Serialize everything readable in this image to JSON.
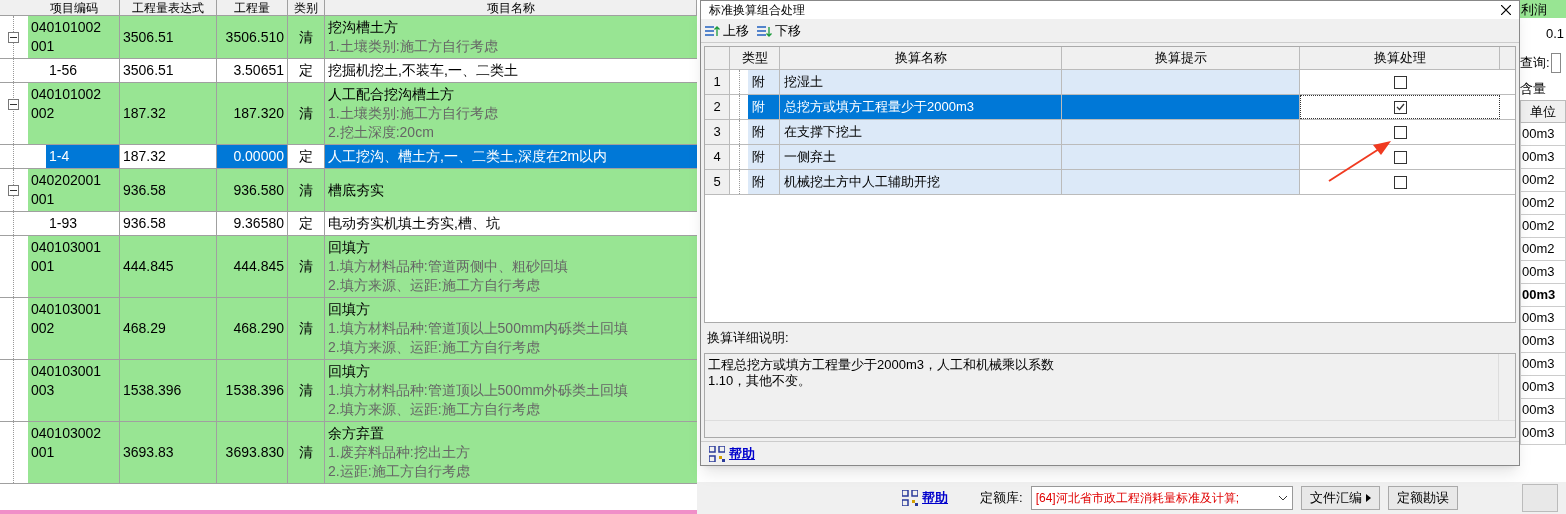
{
  "main_table": {
    "columns": [
      "项目编码",
      "工程量表达式",
      "工程量",
      "类别",
      "项目名称"
    ],
    "rows": [
      {
        "kind": "bill",
        "code": "040101002001",
        "expression": "3506.51",
        "quantity": "3506.510",
        "type": "清",
        "title": "挖沟槽土方",
        "desc": [
          "1.土壤类别:施工方自行考虑"
        ],
        "expanded": true,
        "selected": false,
        "children": [
          {
            "kind": "norm",
            "code": "1-56",
            "expression": "3506.51",
            "quantity": "3.50651",
            "type": "定",
            "title": "挖掘机挖土,不装车,一、二类土",
            "selected": false
          }
        ]
      },
      {
        "kind": "bill",
        "code": "040101002002",
        "expression": "187.32",
        "quantity": "187.320",
        "type": "清",
        "title": "人工配合挖沟槽土方",
        "desc": [
          "1.土壤类别:施工方自行考虑",
          "2.挖土深度:20cm"
        ],
        "expanded": true,
        "selected": false,
        "children": [
          {
            "kind": "norm",
            "code": "1-4",
            "expression": "187.32",
            "quantity": "0.00000",
            "type": "定",
            "title": "人工挖沟、槽土方,一、二类土,深度在2m以内",
            "selected": true
          }
        ]
      },
      {
        "kind": "bill",
        "code": "040202001001",
        "expression": "936.58",
        "quantity": "936.580",
        "type": "清",
        "title": "槽底夯实",
        "desc": [],
        "expanded": true,
        "selected": false,
        "children": [
          {
            "kind": "norm",
            "code": "1-93",
            "expression": "936.58",
            "quantity": "9.36580",
            "type": "定",
            "title": "电动夯实机填土夯实,槽、坑",
            "selected": false
          }
        ]
      },
      {
        "kind": "bill",
        "code": "040103001001",
        "expression": "444.845",
        "quantity": "444.845",
        "type": "清",
        "title": "回填方",
        "desc": [
          "1.填方材料品种:管道两侧中、粗砂回填",
          "2.填方来源、运距:施工方自行考虑"
        ],
        "selected": false
      },
      {
        "kind": "bill",
        "code": "040103001002",
        "expression": "468.29",
        "quantity": "468.290",
        "type": "清",
        "title": "回填方",
        "desc": [
          "1.填方材料品种:管道顶以上500mm内砾类土回填",
          "2.填方来源、运距:施工方自行考虑"
        ],
        "selected": false
      },
      {
        "kind": "bill",
        "code": "040103001003",
        "expression": "1538.396",
        "quantity": "1538.396",
        "type": "清",
        "title": "回填方",
        "desc": [
          "1.填方材料品种:管道顶以上500mm外砾类土回填",
          "2.填方来源、运距:施工方自行考虑"
        ],
        "selected": false
      },
      {
        "kind": "bill",
        "code": "040103002001",
        "expression": "3693.83",
        "quantity": "3693.830",
        "type": "清",
        "title": "余方弃置",
        "desc": [
          "1.废弃料品种:挖出土方",
          "2.运距:施工方自行考虑"
        ],
        "selected": false
      }
    ]
  },
  "side_panel": {
    "column_heading": "利润",
    "value": "0.1",
    "query_label": "查询:",
    "content_heading": "含量",
    "unit_heading": "单位",
    "units": [
      {
        "text": "00m3",
        "emphasized": false
      },
      {
        "text": "00m3",
        "emphasized": false
      },
      {
        "text": "00m2",
        "emphasized": false
      },
      {
        "text": "00m2",
        "emphasized": false
      },
      {
        "text": "00m2",
        "emphasized": false
      },
      {
        "text": "00m2",
        "emphasized": false
      },
      {
        "text": "00m3",
        "emphasized": false
      },
      {
        "text": "00m3",
        "emphasized": true
      },
      {
        "text": "00m3",
        "emphasized": false
      },
      {
        "text": "00m3",
        "emphasized": false
      },
      {
        "text": "00m3",
        "emphasized": false
      },
      {
        "text": "00m3",
        "emphasized": false
      },
      {
        "text": "00m3",
        "emphasized": false
      },
      {
        "text": "00m3",
        "emphasized": false
      }
    ]
  },
  "bottom_bar": {
    "help": "帮助",
    "library_label": "定额库:",
    "library_value": "[64]河北省市政工程消耗量标准及计算;",
    "buttons": [
      {
        "label": "文件汇编",
        "kind": "menu"
      },
      {
        "label": "定额勘误",
        "kind": "plain"
      }
    ]
  },
  "dialog": {
    "title": "标准换算组合处理",
    "toolbar": [
      {
        "label": "上移",
        "kind": "up"
      },
      {
        "label": "下移",
        "kind": "down"
      }
    ],
    "columns": [
      "类型",
      "换算名称",
      "换算提示",
      "换算处理"
    ],
    "rows": [
      {
        "number": "1",
        "type": "附",
        "name": "挖湿土",
        "checked": false,
        "selected": false
      },
      {
        "number": "2",
        "type": "附",
        "name": "总挖方或填方工程量少于2000m3",
        "checked": true,
        "selected": true
      },
      {
        "number": "3",
        "type": "附",
        "name": "在支撑下挖土",
        "checked": false,
        "selected": false
      },
      {
        "number": "4",
        "type": "附",
        "name": "一侧弃土",
        "checked": false,
        "selected": false
      },
      {
        "number": "5",
        "type": "附",
        "name": "机械挖土方中人工辅助开挖",
        "checked": false,
        "selected": false
      }
    ],
    "detail_label": "换算详细说明:",
    "detail_lines": [
      "工程总挖方或填方工程量少于2000m3，人工和机械乘以系数",
      "1.10，其他不变。"
    ],
    "help": "帮助"
  }
}
